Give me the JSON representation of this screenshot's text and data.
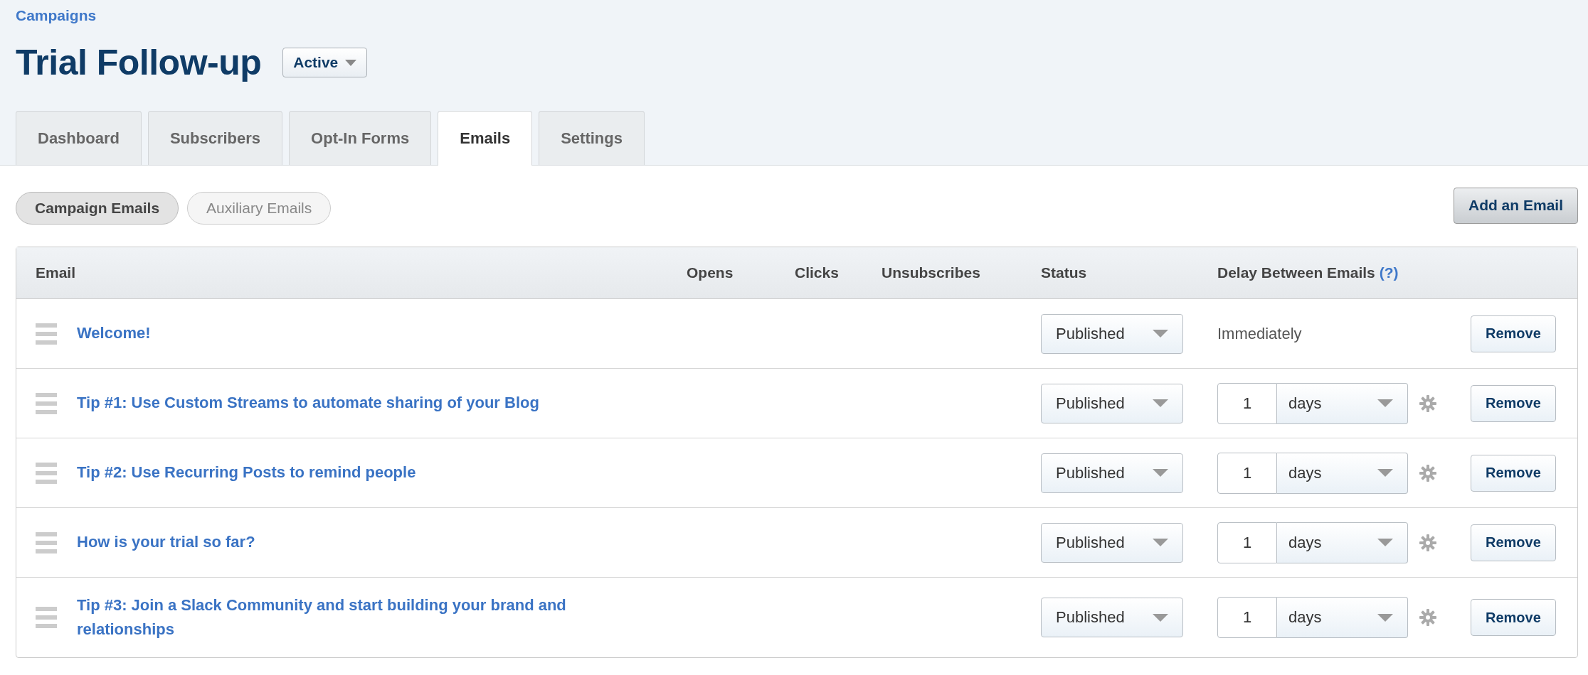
{
  "breadcrumb": "Campaigns",
  "title": "Trial Follow-up",
  "campaign_status": {
    "value": "Active"
  },
  "tabs": [
    {
      "label": "Dashboard",
      "selected": false
    },
    {
      "label": "Subscribers",
      "selected": false
    },
    {
      "label": "Opt-In Forms",
      "selected": false
    },
    {
      "label": "Emails",
      "selected": true
    },
    {
      "label": "Settings",
      "selected": false
    }
  ],
  "filters": [
    {
      "label": "Campaign Emails",
      "selected": true
    },
    {
      "label": "Auxiliary Emails",
      "selected": false
    }
  ],
  "add_button": "Add an Email",
  "table": {
    "columns": [
      "Email",
      "Opens",
      "Clicks",
      "Unsubscribes",
      "Status",
      "Delay Between Emails"
    ],
    "help_link": "(?)",
    "rows": [
      {
        "email": "Welcome!",
        "status": "Published",
        "kind": "immediate",
        "delay_text": "Immediately",
        "action": "Remove"
      },
      {
        "email": "Tip #1: Use Custom Streams to automate sharing of your Blog",
        "status": "Published",
        "kind": "delay",
        "delay_value": "1",
        "delay_unit": "days",
        "action": "Remove"
      },
      {
        "email": "Tip #2: Use Recurring Posts to remind people",
        "status": "Published",
        "kind": "delay",
        "delay_value": "1",
        "delay_unit": "days",
        "action": "Remove"
      },
      {
        "email": "How is your trial so far?",
        "status": "Published",
        "kind": "delay",
        "delay_value": "1",
        "delay_unit": "days",
        "action": "Remove"
      },
      {
        "email": "Tip #3: Join a Slack Community and start building your brand and relationships",
        "status": "Published",
        "kind": "delay",
        "delay_value": "1",
        "delay_unit": "days",
        "action": "Remove"
      }
    ]
  }
}
